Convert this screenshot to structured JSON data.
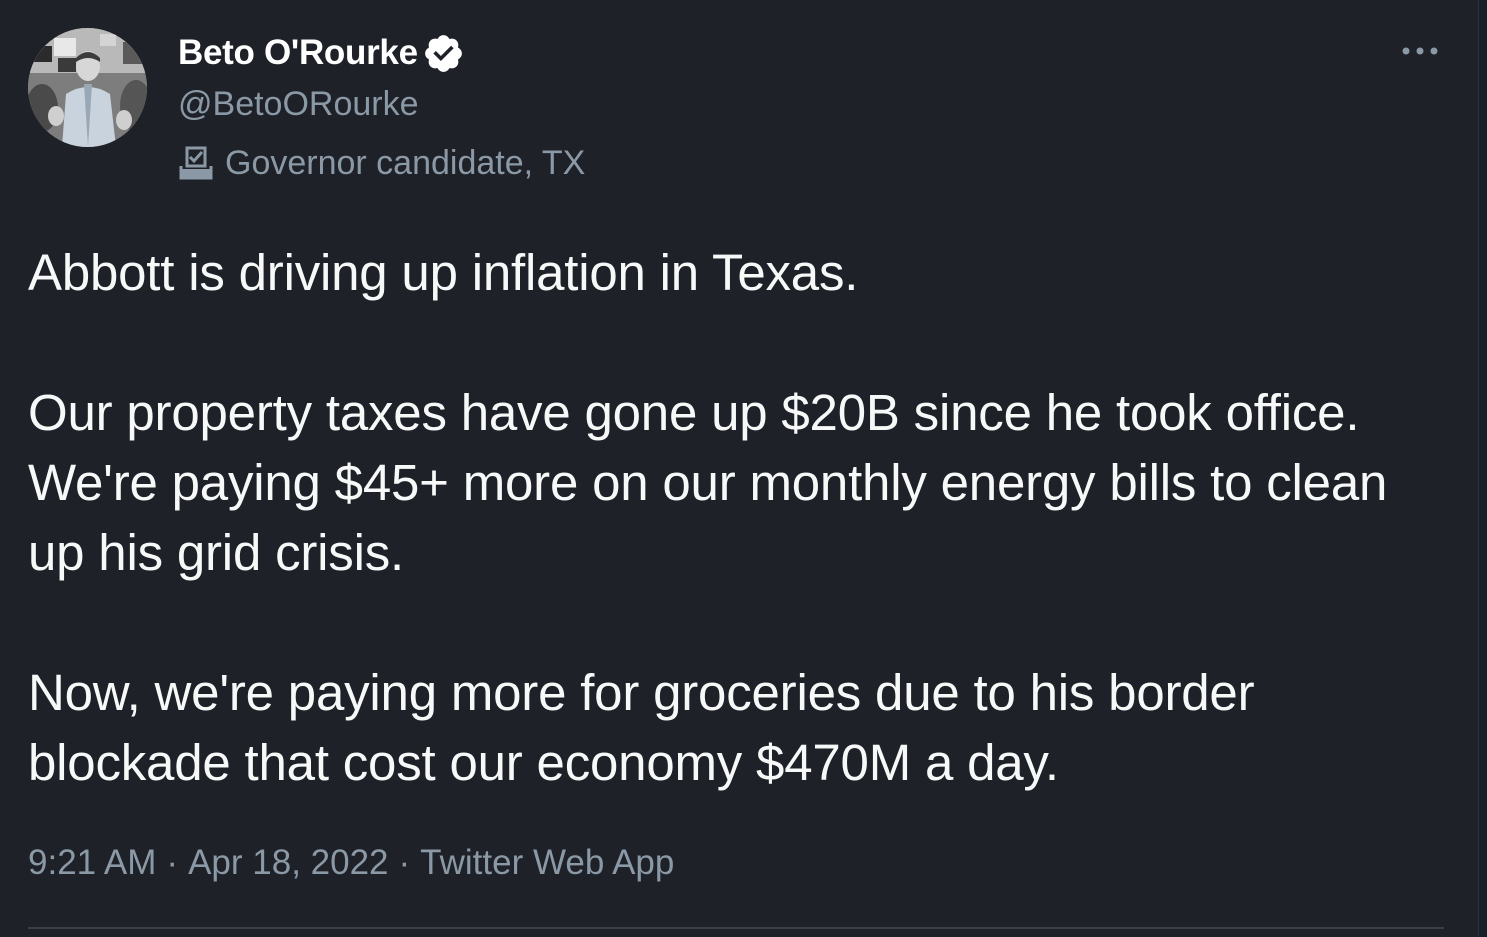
{
  "tweet": {
    "author": {
      "display_name": "Beto O'Rourke",
      "handle": "@BetoORourke",
      "verified": true,
      "label_icon": "ballot-box-icon",
      "label": "Governor candidate, TX"
    },
    "paragraphs": [
      "Abbott is driving up inflation in Texas.",
      "Our property taxes have gone up $20B since he took office. We're paying $45+ more on our monthly energy bills to clean up his grid crisis.",
      "Now, we're paying more for groceries due to his border blockade that cost our economy $470M a day."
    ],
    "time": "9:21 AM",
    "date": "Apr 18, 2022",
    "separator": "·",
    "source": "Twitter Web App",
    "more_icon": "more-horizontal-icon"
  },
  "colors": {
    "background": "#1e2128",
    "text": "#f7f9f9",
    "secondary_text": "#8b98a5",
    "verified_badge": "#ffffff"
  }
}
